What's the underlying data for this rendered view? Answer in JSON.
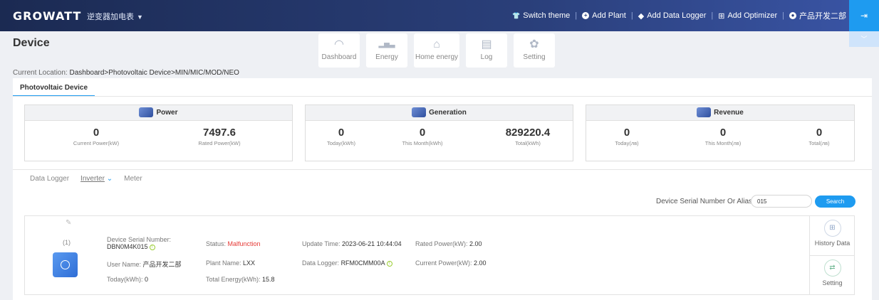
{
  "header": {
    "logo": "GROWATT",
    "plant_name": "逆变器加电表",
    "plant_caret": "▼",
    "links": [
      {
        "icon": "shirt-icon",
        "glyph": "👕",
        "label": "Switch theme"
      },
      {
        "icon": "plus-circle-icon",
        "glyph": "+",
        "label": "Add Plant"
      },
      {
        "icon": "diamond-icon",
        "glyph": "◆",
        "label": "Add Data Logger"
      },
      {
        "icon": "optimizer-icon",
        "glyph": "⊞",
        "label": "Add Optimizer"
      },
      {
        "icon": "user-icon",
        "glyph": "●",
        "label": "产品开发二部"
      }
    ],
    "logout_glyph": "⇥",
    "collapse_glyph": "﹀"
  },
  "page": {
    "title": "Device",
    "breadcrumb_prefix": "Current Location: ",
    "breadcrumb_path": "Dashboard>Photovoltaic Device>MIN/MIC/MOD/NEO"
  },
  "nav": [
    {
      "label": "Dashboard",
      "icon": "gauge-icon",
      "glyph": "◠"
    },
    {
      "label": "Energy",
      "icon": "bar-chart-icon",
      "glyph": "▂▅▃"
    },
    {
      "label": "Home energy",
      "icon": "home-icon",
      "glyph": "⌂"
    },
    {
      "label": "Log",
      "icon": "log-icon",
      "glyph": "▤"
    },
    {
      "label": "Setting",
      "icon": "gear-icon",
      "glyph": "✿"
    }
  ],
  "subtab": "Photovoltaic Device",
  "cards": {
    "power": {
      "title": "Power",
      "items": [
        {
          "value": "0",
          "label": "Current Power(kW)"
        },
        {
          "value": "7497.6",
          "label": "Rated Power(kW)"
        }
      ]
    },
    "generation": {
      "title": "Generation",
      "items": [
        {
          "value": "0",
          "label": "Today(kWh)"
        },
        {
          "value": "0",
          "label": "This Month(kWh)"
        },
        {
          "value": "829220.4",
          "label": "Total(kWh)"
        }
      ]
    },
    "revenue": {
      "title": "Revenue",
      "items": [
        {
          "value": "0",
          "label": "Today(лв)"
        },
        {
          "value": "0",
          "label": "This Month(лв)"
        },
        {
          "value": "0",
          "label": "Total(лв)"
        }
      ]
    }
  },
  "device_tabs": [
    "Data Logger",
    "Inverter",
    "Meter"
  ],
  "device_tab_caret": "⌄",
  "search": {
    "label": "Device Serial Number Or Alias:",
    "value": "015",
    "button": "Search"
  },
  "device": {
    "edit_glyph": "✎",
    "index": "(1)",
    "serial_label": "Device Serial Number:",
    "serial_value": "DBN0M4K015",
    "status_label": "Status:",
    "status_value": "Malfunction",
    "status_color": "#e53935",
    "update_label": "Update Time:",
    "update_value": "2023-06-21 10:44:04",
    "rated_label": "Rated Power(kW):",
    "rated_value": "2.00",
    "user_label": "User Name:",
    "user_value": "产品开发二部",
    "plant_label": "Plant Name:",
    "plant_value": "LXX",
    "logger_label": "Data Logger:",
    "logger_value": "RFM0CMM00A",
    "current_label": "Current Power(kW):",
    "current_value": "2.00",
    "today_label": "Today(kWh):",
    "today_value": "0",
    "total_label": "Total Energy(kWh):",
    "total_value": "15.8",
    "warn_glyph": "!",
    "actions": [
      {
        "label": "History Data",
        "icon": "history-icon",
        "glyph": "⊞"
      },
      {
        "label": "Setting",
        "icon": "sliders-icon",
        "glyph": "⇄"
      }
    ]
  },
  "accent_color": "#1e9bf0"
}
